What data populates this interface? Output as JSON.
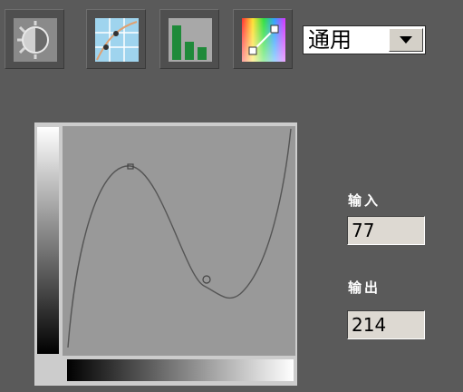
{
  "toolbar": {
    "buttons": [
      {
        "id": "brightness",
        "icon": "brightness-contrast-icon"
      },
      {
        "id": "curves",
        "icon": "curves-icon"
      },
      {
        "id": "levels",
        "icon": "levels-histogram-icon"
      },
      {
        "id": "color",
        "icon": "color-balance-icon"
      }
    ],
    "mode_select": {
      "value": "通用"
    }
  },
  "curve_panel": {
    "input_label": "输入",
    "input_value": "77",
    "output_label": "输出",
    "output_value": "214"
  },
  "colors": {
    "background": "#5a5a5a",
    "curve_area": "#999999",
    "curve_line": "#555555"
  }
}
